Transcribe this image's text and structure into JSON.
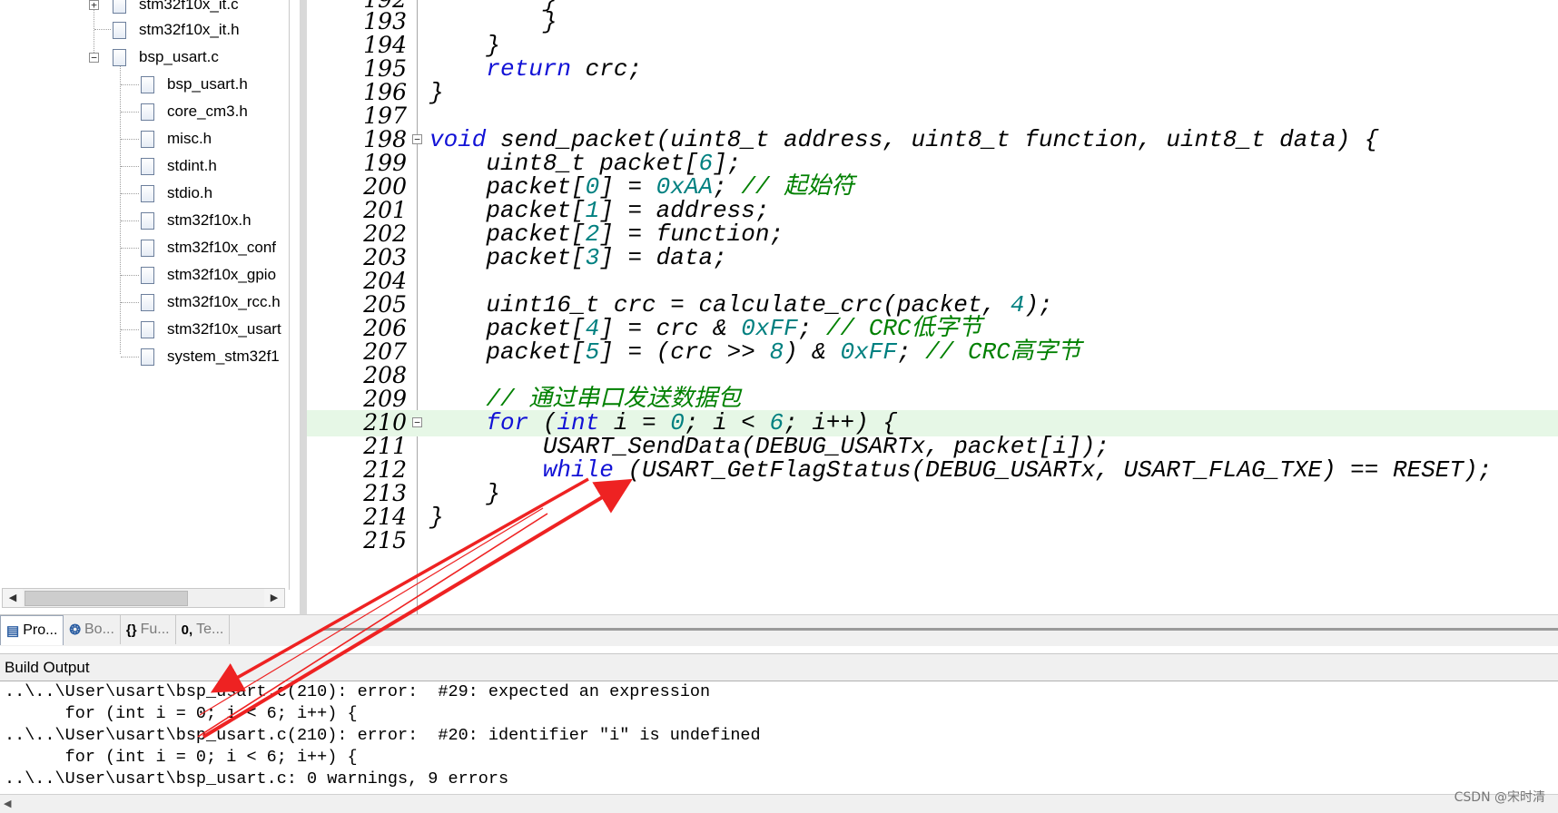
{
  "project_tree": {
    "items": [
      {
        "name": "stm32f10x_it.c",
        "expander": "+"
      },
      {
        "name": "stm32f10x_it.h"
      },
      {
        "name": "bsp_usart.c",
        "expander": "−"
      },
      {
        "name": "bsp_usart.h"
      },
      {
        "name": "core_cm3.h"
      },
      {
        "name": "misc.h"
      },
      {
        "name": "stdint.h"
      },
      {
        "name": "stdio.h"
      },
      {
        "name": "stm32f10x.h"
      },
      {
        "name": "stm32f10x_conf"
      },
      {
        "name": "stm32f10x_gpio"
      },
      {
        "name": "stm32f10x_rcc.h"
      },
      {
        "name": "stm32f10x_usart"
      },
      {
        "name": "system_stm32f1"
      }
    ],
    "scroll_left_arrow": "◀",
    "scroll_right_arrow": "▶"
  },
  "panel_tabs": [
    {
      "label": "Pro...",
      "icon": "project-icon",
      "glyph": "▤"
    },
    {
      "label": "Bo...",
      "icon": "books-icon",
      "glyph": "❂"
    },
    {
      "label": "Fu...",
      "icon": "functions-icon",
      "glyph": "{}"
    },
    {
      "label": "Te...",
      "icon": "templates-icon",
      "glyph": "0,"
    }
  ],
  "editor": {
    "first_line_number": "192",
    "lines": [
      {
        "num": "193",
        "text": "        }"
      },
      {
        "num": "194",
        "text": "    }"
      },
      {
        "num": "195",
        "text": "    return crc;"
      },
      {
        "num": "196",
        "text": "}"
      },
      {
        "num": "197",
        "text": ""
      },
      {
        "num": "198",
        "text": "void send_packet(uint8_t address, uint8_t function, uint8_t data) {"
      },
      {
        "num": "199",
        "text": "    uint8_t packet[6];"
      },
      {
        "num": "200",
        "text": "    packet[0] = 0xAA; // 起始符"
      },
      {
        "num": "201",
        "text": "    packet[1] = address;"
      },
      {
        "num": "202",
        "text": "    packet[2] = function;"
      },
      {
        "num": "203",
        "text": "    packet[3] = data;"
      },
      {
        "num": "204",
        "text": ""
      },
      {
        "num": "205",
        "text": "    uint16_t crc = calculate_crc(packet, 4);"
      },
      {
        "num": "206",
        "text": "    packet[4] = crc & 0xFF; // CRC低字节"
      },
      {
        "num": "207",
        "text": "    packet[5] = (crc >> 8) & 0xFF; // CRC高字节"
      },
      {
        "num": "208",
        "text": ""
      },
      {
        "num": "209",
        "text": "    // 通过串口发送数据包"
      },
      {
        "num": "210",
        "text": "    for (int i = 0; i < 6; i++) {"
      },
      {
        "num": "211",
        "text": "        USART_SendData(DEBUG_USARTx, packet[i]);"
      },
      {
        "num": "212",
        "text": "        while (USART_GetFlagStatus(DEBUG_USARTx, USART_FLAG_TXE) == RESET);"
      },
      {
        "num": "213",
        "text": "    }"
      },
      {
        "num": "214",
        "text": "}"
      },
      {
        "num": "215",
        "text": ""
      }
    ],
    "highlighted_line": "210",
    "fold_lines": [
      "198",
      "210"
    ]
  },
  "build_output": {
    "title": "Build Output",
    "lines": [
      "..\\..\\User\\usart\\bsp_usart.c(210): error:  #29: expected an expression",
      "      for (int i = 0; i < 6; i++) {",
      "..\\..\\User\\usart\\bsp_usart.c(210): error:  #20: identifier \"i\" is undefined",
      "      for (int i = 0; i < 6; i++) {",
      "..\\..\\User\\usart\\bsp_usart.c: 0 warnings, 9 errors"
    ],
    "scroll_left_arrow": "◀"
  },
  "watermark": "CSDN @宋时清",
  "colors": {
    "keyword": "#1212d6",
    "number": "#008080",
    "comment": "#008000",
    "highlight_line": "#e6f7e6",
    "annotation_arrow": "#ee2222"
  }
}
